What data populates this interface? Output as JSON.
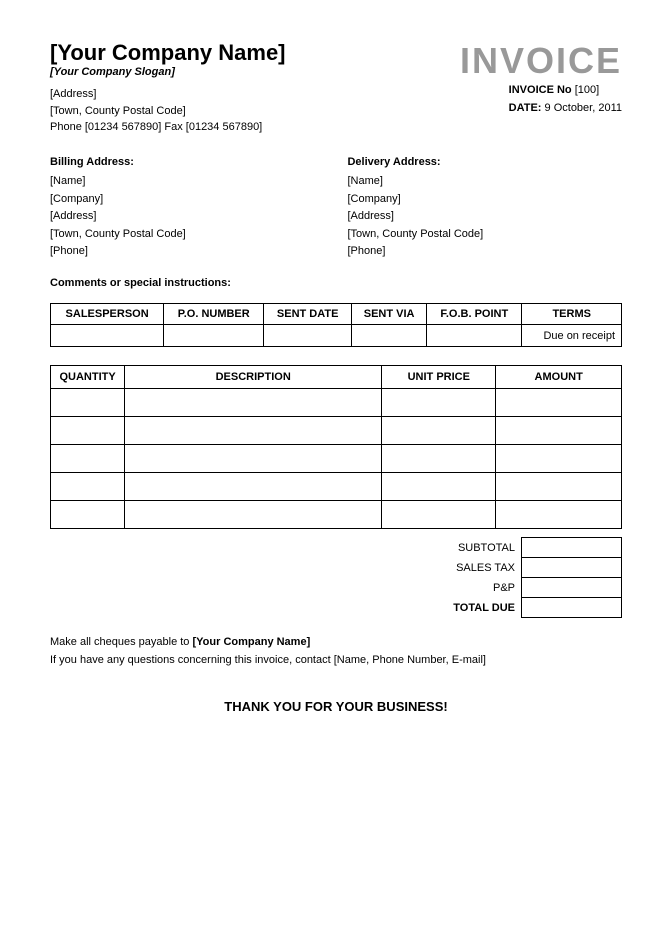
{
  "header": {
    "company_name": "[Your Company Name]",
    "company_slogan": "[Your Company Slogan]",
    "address_line1": "[Address]",
    "address_line2": "[Town, County Postal Code]",
    "address_line3": "Phone [01234 567890] Fax [01234 567890]",
    "invoice_title": "INVOICE",
    "invoice_no_label": "INVOICE No",
    "invoice_no_value": "[100]",
    "date_label": "DATE:",
    "date_value": "9 October, 2011"
  },
  "billing": {
    "title": "Billing Address:",
    "name": "[Name]",
    "company": "[Company]",
    "address": "[Address]",
    "town": "[Town, County Postal Code]",
    "phone": "[Phone]"
  },
  "delivery": {
    "title": "Delivery Address:",
    "name": "[Name]",
    "company": "[Company]",
    "address": "[Address]",
    "town": "[Town, County Postal Code]",
    "phone": "[Phone]"
  },
  "comments": {
    "label": "Comments or special instructions:"
  },
  "salesperson_table": {
    "headers": [
      "SALESPERSON",
      "P.O. NUMBER",
      "SENT DATE",
      "SENT VIA",
      "F.O.B. POINT",
      "TERMS"
    ],
    "row": {
      "salesperson": "",
      "po_number": "",
      "sent_date": "",
      "sent_via": "",
      "fob_point": "",
      "terms": "Due on receipt"
    }
  },
  "items_table": {
    "headers": [
      "QUANTITY",
      "DESCRIPTION",
      "UNIT PRICE",
      "AMOUNT"
    ],
    "rows": [
      {
        "qty": "",
        "desc": "",
        "unit": "",
        "amount": ""
      },
      {
        "qty": "",
        "desc": "",
        "unit": "",
        "amount": ""
      },
      {
        "qty": "",
        "desc": "",
        "unit": "",
        "amount": ""
      },
      {
        "qty": "",
        "desc": "",
        "unit": "",
        "amount": ""
      },
      {
        "qty": "",
        "desc": "",
        "unit": "",
        "amount": ""
      }
    ]
  },
  "totals": {
    "subtotal_label": "SUBTOTAL",
    "subtotal_value": "",
    "sales_tax_label": "SALES TAX",
    "sales_tax_value": "",
    "pnp_label": "P&P",
    "pnp_value": "",
    "total_due_label": "TOTAL DUE",
    "total_due_value": ""
  },
  "footer": {
    "cheques_text_prefix": "Make all cheques payable to ",
    "cheques_bold": "[Your Company Name]",
    "questions_text": "If you have any questions concerning this invoice, contact [Name, Phone Number, E-mail]",
    "thank_you": "THANK YOU FOR YOUR BUSINESS!"
  }
}
